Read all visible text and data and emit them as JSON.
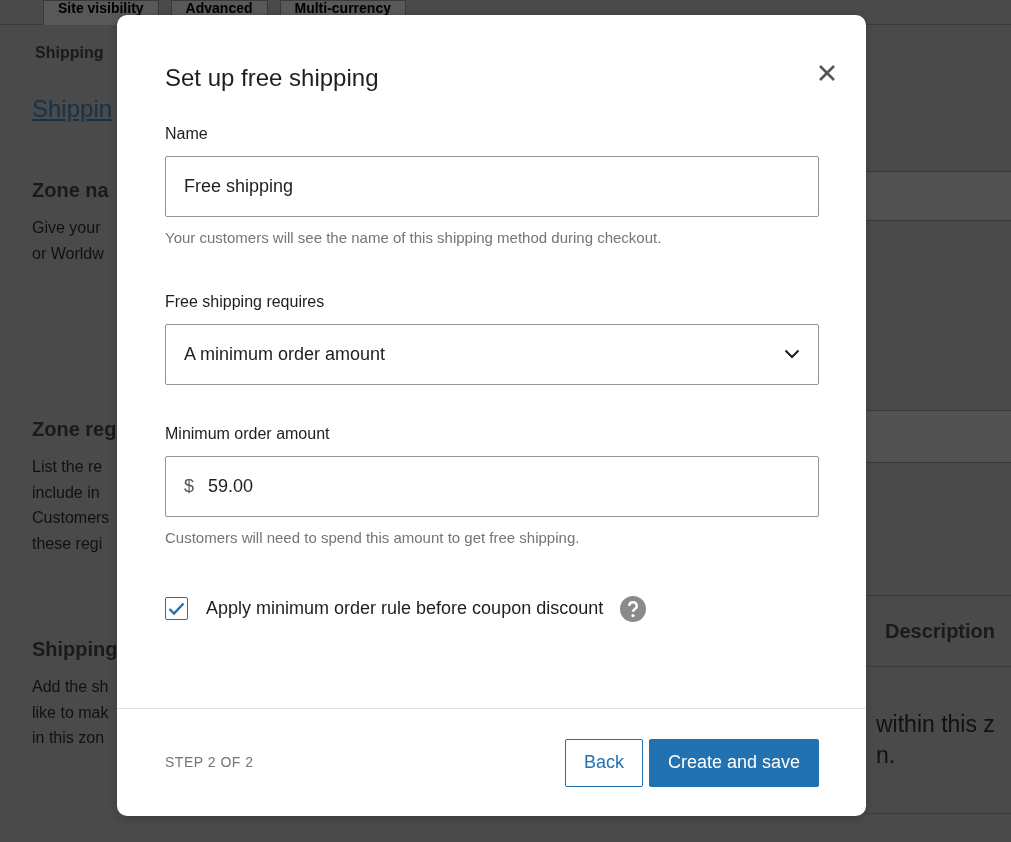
{
  "background": {
    "tabs": [
      {
        "label": "Site visibility"
      },
      {
        "label": "Advanced"
      },
      {
        "label": "Multi-currency"
      }
    ],
    "subnav": "Shipping",
    "heading_link": "Shippin",
    "sections": [
      {
        "title": "Zone na",
        "lines": [
          "Give your",
          "or Worldw"
        ]
      },
      {
        "title": "Zone reg",
        "lines": [
          "List the re",
          "include in",
          "Customers",
          "these regi"
        ]
      },
      {
        "title": "Shipping",
        "lines": [
          "Add the sh",
          "like to mak",
          "in this zon"
        ]
      }
    ],
    "table": {
      "column_header": "Description",
      "lines": [
        "within this z",
        "n."
      ]
    }
  },
  "modal": {
    "title": "Set up free shipping",
    "name_field": {
      "label": "Name",
      "value": "Free shipping",
      "help": "Your customers will see the name of this shipping method during checkout."
    },
    "requires_field": {
      "label": "Free shipping requires",
      "value": "A minimum order amount"
    },
    "amount_field": {
      "label": "Minimum order amount",
      "prefix": "$",
      "value": "59.00",
      "help": "Customers will need to spend this amount to get free shipping."
    },
    "coupon_rule": {
      "label": "Apply minimum order rule before coupon discount",
      "checked": true
    },
    "step": "STEP 2 OF 2",
    "buttons": [
      {
        "label": "Back",
        "kind": "secondary"
      },
      {
        "label": "Create and save",
        "kind": "primary"
      }
    ]
  }
}
